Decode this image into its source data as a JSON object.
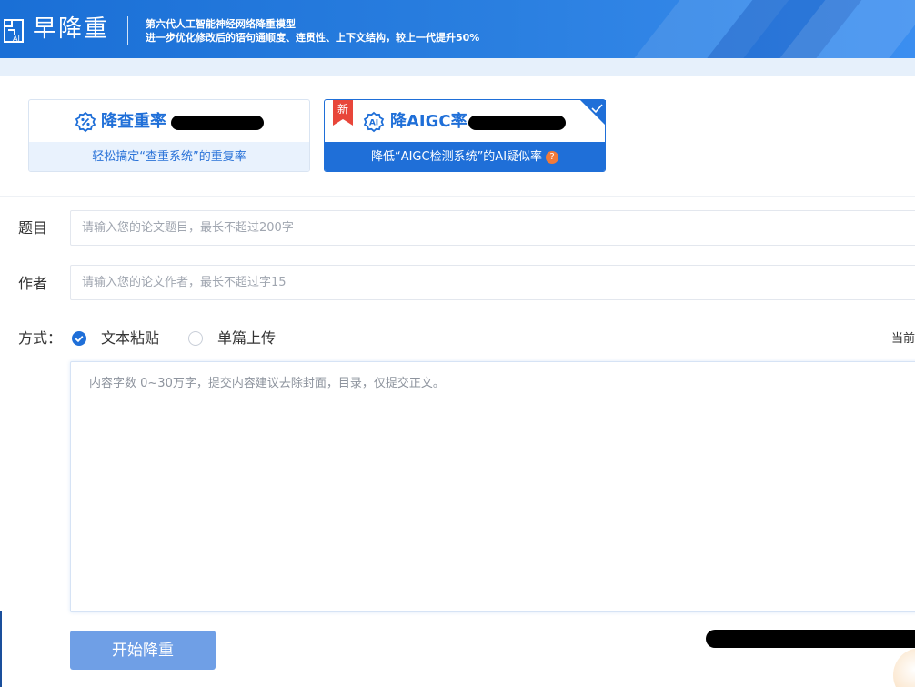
{
  "header": {
    "logo_text": "早降重",
    "logo_mark_label": "AI",
    "tagline_line1": "第六代人工智能神经网络降重模型",
    "tagline_line2": "进一步优化修改后的语句通顺度、连贯性、上下文结构，较上一代提升50%"
  },
  "modes": {
    "plagiarism": {
      "title": "降查重率",
      "subtitle": "轻松搞定“查重系统”的重复率"
    },
    "aigc": {
      "badge": "新",
      "title": "降AIGC率",
      "subtitle": "降低“AIGC检测系统”的AI疑似率",
      "help": "?"
    }
  },
  "form": {
    "title_label": "题目",
    "title_placeholder": "请输入您的论文题目，最长不超过200字",
    "author_label": "作者",
    "author_placeholder": "请输入您的论文作者，最长不超过字15",
    "method_label": "方式：",
    "method_options": [
      "文本粘贴",
      "单篇上传"
    ],
    "method_selected": "文本粘贴",
    "current_text": "当前",
    "content_placeholder": "内容字数 0~30万字，提交内容建议去除封面，目录，仅提交正文。",
    "submit_label": "开始降重"
  },
  "colors": {
    "brand_blue": "#1f6fd8",
    "banner_blue": "#2a7fe0",
    "submit_blue": "#6f9fe6",
    "new_badge_red": "#e8463a",
    "help_orange": "#f07a3a"
  }
}
